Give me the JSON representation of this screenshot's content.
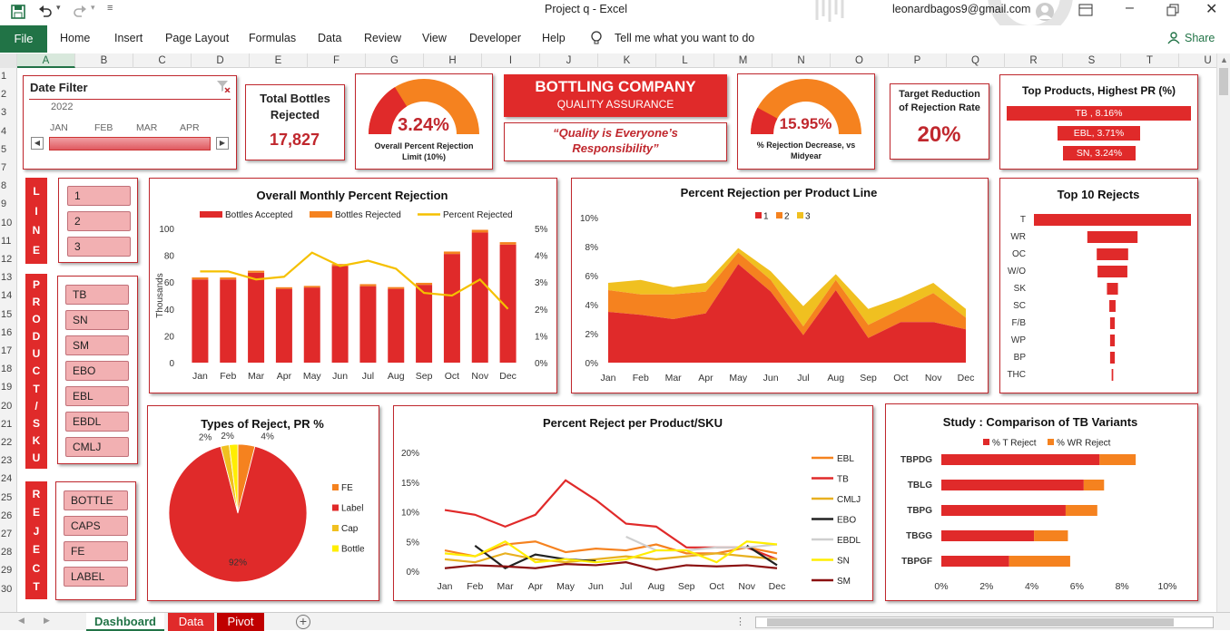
{
  "window": {
    "title": "Project q  -  Excel",
    "user_email": "leonardbagos9@gmail.com",
    "tell_me": "Tell me what you want to do",
    "share": "Share"
  },
  "ribbon": {
    "file": "File",
    "tabs": [
      "Home",
      "Insert",
      "Page Layout",
      "Formulas",
      "Data",
      "Review",
      "View",
      "Developer",
      "Help"
    ]
  },
  "columns": [
    "A",
    "B",
    "C",
    "D",
    "E",
    "F",
    "G",
    "H",
    "I",
    "J",
    "K",
    "L",
    "M",
    "N",
    "O",
    "P",
    "Q",
    "R",
    "S",
    "T",
    "U"
  ],
  "rows": [
    "1",
    "2",
    "3",
    "4",
    "5",
    "7",
    "8",
    "9",
    "10",
    "11",
    "12",
    "13",
    "14",
    "15",
    "16",
    "17",
    "18",
    "19",
    "20",
    "21",
    "22",
    "23",
    "24",
    "25",
    "26",
    "27",
    "28",
    "29",
    "30"
  ],
  "date_filter": {
    "title": "Date Filter",
    "year": "2022",
    "months": [
      "JAN",
      "FEB",
      "MAR",
      "APR"
    ]
  },
  "total_bottles": {
    "title": "Total Bottles Rejected",
    "value": "17,827"
  },
  "gauge1": {
    "value": "3.24%",
    "fraction": 0.324,
    "label": "Overall Percent Rejection Limit (10%)"
  },
  "company": {
    "name": "BOTTLING COMPANY",
    "subtitle": "QUALITY ASSURANCE",
    "slogan": "“Quality is Everyone’s Responsibility”"
  },
  "gauge2": {
    "value": "15.95%",
    "fraction": 0.1595,
    "label": "% Rejection Decrease, vs Midyear"
  },
  "target": {
    "title": "Target Reduction of Rejection Rate",
    "value": "20%"
  },
  "top_products": {
    "title": "Top Products, Highest PR (%)",
    "items": [
      "TB , 8.16%",
      "EBL, 3.71%",
      "SN, 3.24%"
    ],
    "values": [
      8.16,
      3.71,
      3.24
    ]
  },
  "slicers": {
    "line": {
      "label": "LINE",
      "items": [
        "1",
        "2",
        "3"
      ]
    },
    "product": {
      "label": "PRODUCT/SKU",
      "items": [
        "TB",
        "SN",
        "SM",
        "EBO",
        "EBL",
        "EBDL",
        "CMLJ"
      ]
    },
    "reject": {
      "label": "REJECT",
      "items": [
        "BOTTLE",
        "CAPS",
        "FE",
        "LABEL"
      ]
    }
  },
  "sheet_tabs": [
    "Dashboard",
    "Data",
    "Pivot"
  ],
  "colors": {
    "red": "#e02a2a",
    "orange": "#f5821f",
    "gold": "#f0c020",
    "yellow": "#ffee00",
    "excel_green": "#217346"
  },
  "chart_data": [
    {
      "type": "bar",
      "title": "Overall Monthly Percent Rejection",
      "categories": [
        "Jan",
        "Feb",
        "Mar",
        "Apr",
        "May",
        "Jun",
        "Jul",
        "Aug",
        "Sep",
        "Oct",
        "Nov",
        "Dec"
      ],
      "series": [
        {
          "name": "Bottles Accepted",
          "values": [
            62,
            62,
            67,
            55,
            56,
            72,
            57,
            55,
            58,
            81,
            97,
            88
          ]
        },
        {
          "name": "Bottles Rejected",
          "values": [
            1.5,
            1.5,
            1.5,
            1.2,
            1.2,
            1.5,
            1.5,
            1.3,
            1.5,
            1.8,
            2,
            1.8
          ]
        },
        {
          "name": "Percent Rejected",
          "axis": "right",
          "values": [
            3.4,
            3.4,
            3.1,
            3.2,
            4.1,
            3.6,
            3.8,
            3.5,
            2.6,
            2.5,
            3.1,
            2.0
          ]
        }
      ],
      "ylabel": "Thousands",
      "ylim": [
        0,
        100
      ],
      "yticks": [
        "0",
        "20",
        "40",
        "60",
        "80",
        "100"
      ],
      "y2lim": [
        0,
        5
      ],
      "y2ticks": [
        "0%",
        "1%",
        "2%",
        "3%",
        "4%",
        "5%"
      ]
    },
    {
      "type": "area",
      "title": "Percent Rejection per Product Line",
      "categories": [
        "Jan",
        "Feb",
        "Mar",
        "Apr",
        "May",
        "Jun",
        "Jul",
        "Aug",
        "Sep",
        "Oct",
        "Nov",
        "Dec"
      ],
      "series": [
        {
          "name": "1",
          "values": [
            3.5,
            3.3,
            3.0,
            3.4,
            6.8,
            4.9,
            1.9,
            5.0,
            1.7,
            2.8,
            2.8,
            2.3
          ]
        },
        {
          "name": "2",
          "values": [
            1.5,
            1.4,
            1.7,
            1.5,
            0.8,
            0.8,
            0.6,
            0.7,
            0.9,
            0.9,
            2.0,
            0.8
          ]
        },
        {
          "name": "3",
          "values": [
            0.5,
            1.0,
            0.5,
            0.6,
            0.3,
            0.6,
            1.4,
            0.4,
            1.1,
            0.8,
            0.7,
            0.6
          ]
        }
      ],
      "ylim": [
        0,
        10
      ],
      "yticks": [
        "0%",
        "2%",
        "4%",
        "6%",
        "8%",
        "10%"
      ]
    },
    {
      "type": "bar",
      "title": "Top 10 Rejects",
      "categories": [
        "T",
        "WR",
        "OC",
        "W/O",
        "SK",
        "SC",
        "F/B",
        "WP",
        "BP",
        "THC"
      ],
      "values": [
        100,
        32,
        20,
        19,
        7,
        4,
        3,
        3,
        3,
        1
      ]
    },
    {
      "type": "pie",
      "title": "Types of Reject, PR %",
      "categories": [
        "FE",
        "Label",
        "Cap",
        "Bottle"
      ],
      "values": [
        4,
        92,
        2,
        2
      ],
      "labels": [
        "4%",
        "92%",
        "2%",
        "2%"
      ]
    },
    {
      "type": "line",
      "title": "Percent Reject per Product/SKU",
      "categories": [
        "Jan",
        "Feb",
        "Mar",
        "Apr",
        "May",
        "Jun",
        "Jul",
        "Aug",
        "Sep",
        "Oct",
        "Nov",
        "Dec"
      ],
      "series": [
        {
          "name": "EBL",
          "values": [
            3.5,
            2.5,
            4.5,
            5.0,
            3.2,
            3.8,
            3.5,
            4.5,
            3.0,
            3.0,
            4.0,
            3.0
          ]
        },
        {
          "name": "TB",
          "values": [
            10.3,
            9.5,
            7.5,
            9.5,
            15.3,
            12.0,
            8.0,
            7.5,
            4.0,
            4.0,
            4.0,
            2.0
          ]
        },
        {
          "name": "CMLJ",
          "values": [
            2.0,
            1.5,
            3.0,
            2.0,
            1.5,
            2.0,
            2.5,
            2.0,
            2.5,
            3.0,
            2.5,
            2.0
          ]
        },
        {
          "name": "EBO",
          "values": [
            null,
            4.3,
            0.5,
            2.8,
            2.0,
            1.7,
            null,
            null,
            null,
            null,
            4.3,
            1.0
          ]
        },
        {
          "name": "EBDL",
          "values": [
            null,
            null,
            null,
            null,
            null,
            null,
            5.8,
            3.5,
            3.5,
            4.0,
            4.0,
            4.5
          ]
        },
        {
          "name": "SN",
          "values": [
            3.0,
            2.5,
            5.0,
            1.5,
            2.0,
            1.5,
            2.0,
            3.5,
            3.5,
            1.5,
            5.0,
            4.5
          ]
        },
        {
          "name": "SM",
          "values": [
            0.5,
            1.0,
            0.8,
            0.5,
            1.2,
            1.0,
            1.5,
            0.2,
            1.0,
            0.8,
            1.0,
            0.5
          ]
        }
      ],
      "ylim": [
        0,
        20
      ],
      "yticks": [
        "0%",
        "5%",
        "10%",
        "15%",
        "20%"
      ]
    },
    {
      "type": "bar",
      "title": "Study : Comparison of TB Variants",
      "categories": [
        "TBPDG",
        "TBLG",
        "TBPG",
        "TBGG",
        "TBPGF"
      ],
      "series": [
        {
          "name": "% T Reject",
          "values": [
            7.0,
            6.3,
            5.5,
            4.1,
            3.0
          ]
        },
        {
          "name": "% WR Reject",
          "values": [
            1.6,
            0.9,
            1.4,
            1.5,
            2.7
          ]
        }
      ],
      "xlim": [
        0,
        10
      ],
      "xticks": [
        "0%",
        "2%",
        "4%",
        "6%",
        "8%",
        "10%"
      ]
    }
  ]
}
